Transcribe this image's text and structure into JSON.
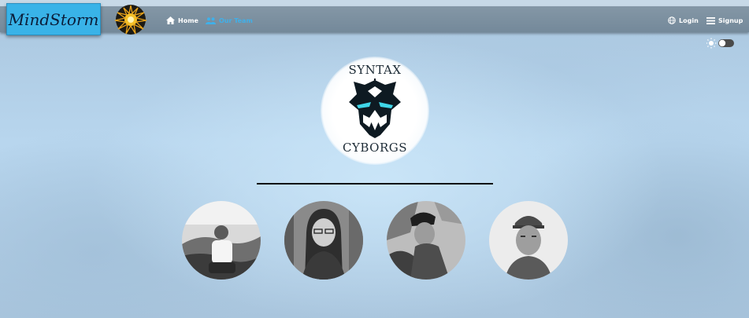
{
  "navbar": {
    "brand": "MindStorm",
    "links": [
      {
        "label": "Home",
        "icon": "home-icon",
        "active": false
      },
      {
        "label": "Our Team",
        "icon": "people-icon",
        "active": true
      }
    ],
    "auth": [
      {
        "label": "Login",
        "icon": "globe-icon"
      },
      {
        "label": "Signup",
        "icon": "menu-icon"
      }
    ]
  },
  "theme_toggle": {
    "left_icon": "sun-icon",
    "right_icon": "moon-icon",
    "state": "light"
  },
  "team_logo": {
    "top_word": "SYNTAX",
    "bottom_word": "CYBORGS",
    "accent": "#3fd6e8"
  },
  "team_members": [
    {
      "photo": "member-photo-1"
    },
    {
      "photo": "member-photo-2"
    },
    {
      "photo": "member-photo-3"
    },
    {
      "photo": "member-photo-4"
    }
  ],
  "colors": {
    "brand_bg": "#39b3e8",
    "navbar_bg": "#7b8fa0",
    "active_link": "#3fb0ea"
  }
}
